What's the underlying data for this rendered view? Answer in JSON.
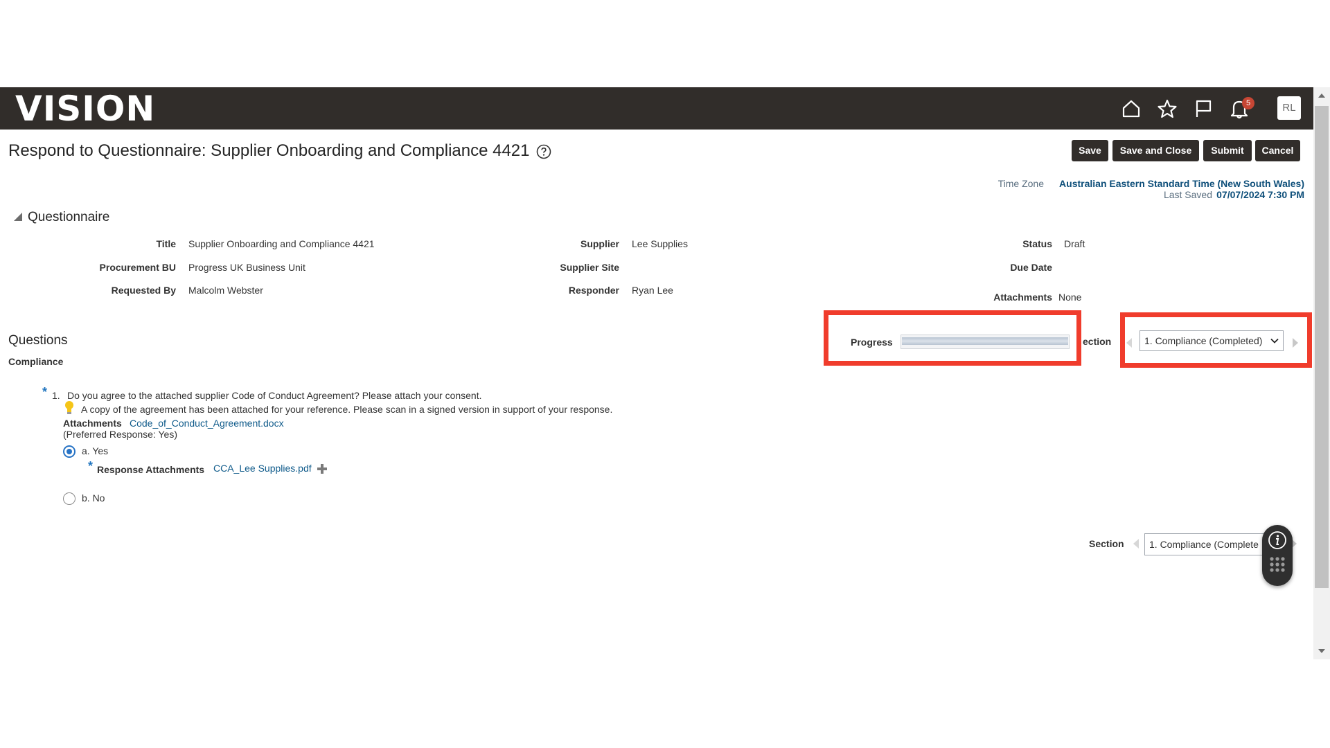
{
  "header": {
    "logo": "VISION",
    "notifications_count": "5",
    "avatar_initials": "RL",
    "icons": [
      "home-icon",
      "star-icon",
      "flag-icon",
      "bell-icon"
    ]
  },
  "page": {
    "title": "Respond to Questionnaire: Supplier Onboarding and Compliance 4421"
  },
  "toolbar": {
    "save": "Save",
    "save_close": "Save and Close",
    "submit": "Submit",
    "cancel": "Cancel"
  },
  "timezone": {
    "label": "Time Zone",
    "value": "Australian Eastern Standard Time (New South Wales)",
    "last_saved_label": "Last Saved",
    "last_saved_value": "07/07/2024 7:30 PM"
  },
  "questionnaire": {
    "heading": "Questionnaire",
    "title_label": "Title",
    "title_value": "Supplier Onboarding and Compliance 4421",
    "bu_label": "Procurement BU",
    "bu_value": "Progress UK Business Unit",
    "requested_label": "Requested By",
    "requested_value": "Malcolm Webster",
    "supplier_label": "Supplier",
    "supplier_value": "Lee Supplies",
    "site_label": "Supplier Site",
    "responder_label": "Responder",
    "responder_value": "Ryan Lee",
    "status_label": "Status",
    "status_value": "Draft",
    "due_label": "Due Date",
    "attachments_label": "Attachments",
    "attachments_value": "None"
  },
  "questions": {
    "heading": "Questions",
    "section_title": "Compliance",
    "progress_label": "Progress",
    "progress_fraction": 1.0,
    "section_label_cut": "ection",
    "section_label": "Section",
    "section_value": "1. Compliance (Completed)",
    "section_value_cut": "1. Compliance (Complete"
  },
  "question1": {
    "number": "1.",
    "text": "Do you agree to the attached supplier Code of Conduct Agreement?  Please attach your consent.",
    "hint": "A copy of the agreement has been attached for your reference. Please scan in a signed version in support of your response.",
    "attachments_label": "Attachments",
    "attachment_file": "Code_of_Conduct_Agreement.docx",
    "preferred": "(Preferred Response: Yes)",
    "option_a": "a. Yes",
    "response_attachments_label": "Response Attachments",
    "response_file": "CCA_Lee Supplies.pdf",
    "option_b": "b. No"
  }
}
